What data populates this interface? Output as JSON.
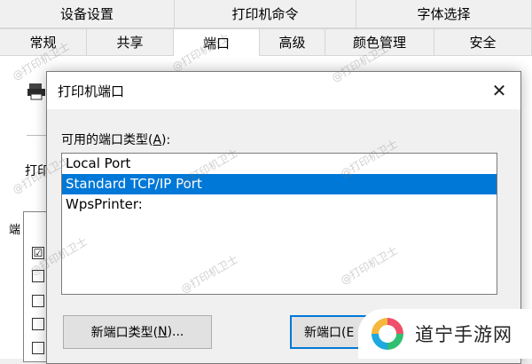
{
  "bg_window": {
    "tabs_row1": [
      "设备设置",
      "打印机命令",
      "字体选择"
    ],
    "tabs_row2": [
      "常规",
      "共享",
      "端口",
      "高级",
      "颜色管理",
      "安全"
    ],
    "active_tab": "端口",
    "print_label": "打印",
    "port_list_header": "端",
    "checkbox_states": [
      "☑",
      "",
      "",
      "",
      ""
    ]
  },
  "dialog": {
    "title": "打印机端口",
    "close_glyph": "✕",
    "ports_label_pre": "可用的端口类型(",
    "ports_label_key": "A",
    "ports_label_post": "):",
    "ports": [
      {
        "label": "Local Port",
        "selected": false
      },
      {
        "label": "Standard TCP/IP Port",
        "selected": true
      },
      {
        "label": "WpsPrinter:",
        "selected": false
      }
    ],
    "btn_new_type_pre": "新端口类型(",
    "btn_new_type_key": "N",
    "btn_new_type_post": ")...",
    "btn_new_port": "新端口(E"
  },
  "watermark_text": "@打印机卫士",
  "badge": {
    "text": "道宁手游网"
  },
  "colors": {
    "selection": "#0078d7",
    "dialog_bg": "#f0f0f0"
  }
}
